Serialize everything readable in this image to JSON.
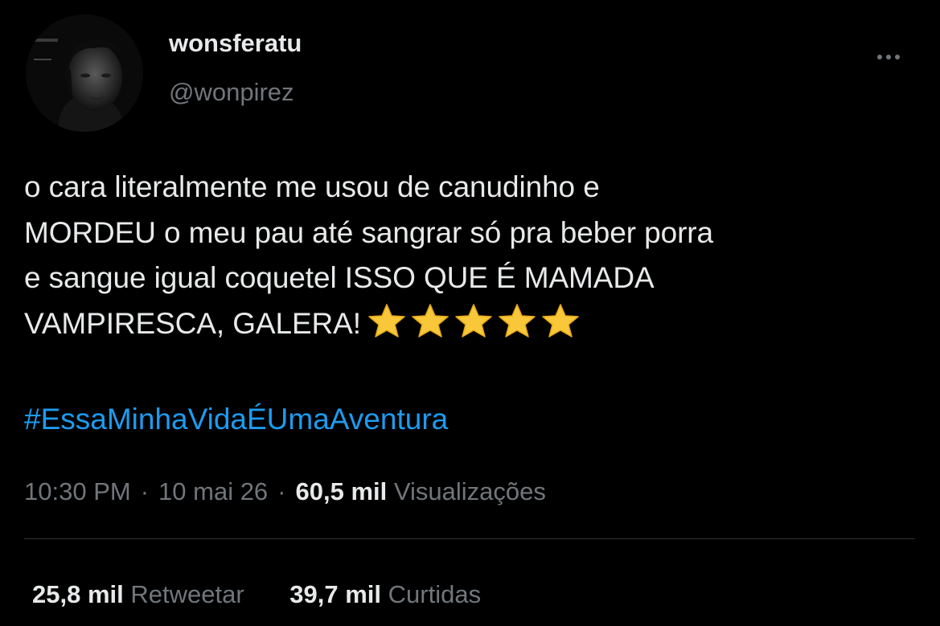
{
  "author": {
    "display_name": "wonsferatu",
    "handle": "@wonpirez",
    "avatar_icon": "profile-photo"
  },
  "menu": {
    "more_icon": "more-horizontal-icon"
  },
  "tweet": {
    "lines": [
      "o cara literalmente me usou de canudinho e",
      "MORDEU o meu pau até sangrar só pra beber porra",
      "e sangue igual coquetel ISSO QUE É MAMADA",
      "VAMPIRESCA, GALERA!"
    ],
    "emoji": [
      "star-icon",
      "star-icon",
      "star-icon",
      "star-icon",
      "star-icon"
    ],
    "hashtag": "#EssaMinhaVidaÉUmaAventura"
  },
  "meta": {
    "time": "10:30 PM",
    "separator": "·",
    "date": "10 mai 26",
    "views_count": "60,5 mil",
    "views_label": "Visualizações"
  },
  "stats": {
    "retweets_count": "25,8 mil",
    "retweets_label": "Retweetar",
    "likes_count": "39,7 mil",
    "likes_label": "Curtidas"
  },
  "colors": {
    "background": "#000000",
    "text_primary": "#e7e9ea",
    "text_secondary": "#71767b",
    "link": "#1d9bf0",
    "divider": "#2f3336",
    "star": "#f8c83a"
  }
}
